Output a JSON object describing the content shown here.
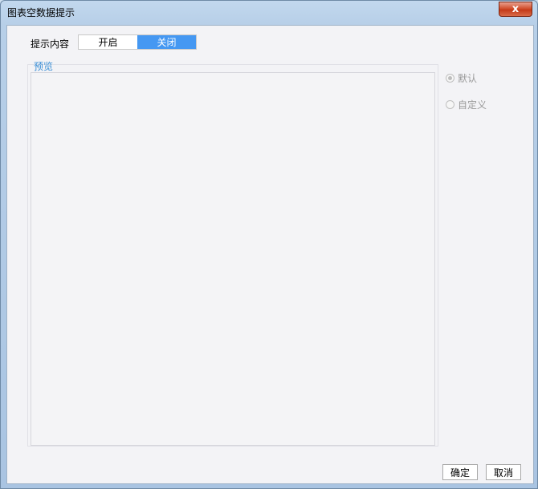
{
  "window": {
    "title": "图表空数据提示",
    "close_label": "x"
  },
  "tip": {
    "label": "提示内容",
    "options": [
      "开启",
      "关闭"
    ],
    "selected": "关闭"
  },
  "preview": {
    "legend": "预览"
  },
  "mode": {
    "options": [
      {
        "label": "默认",
        "checked": true
      },
      {
        "label": "自定义",
        "checked": false
      }
    ]
  },
  "buttons": {
    "ok": "确定",
    "cancel": "取消"
  },
  "colors": {
    "accent": "#4598f2",
    "legend": "#3a8fd6",
    "close": "#c43a18"
  }
}
